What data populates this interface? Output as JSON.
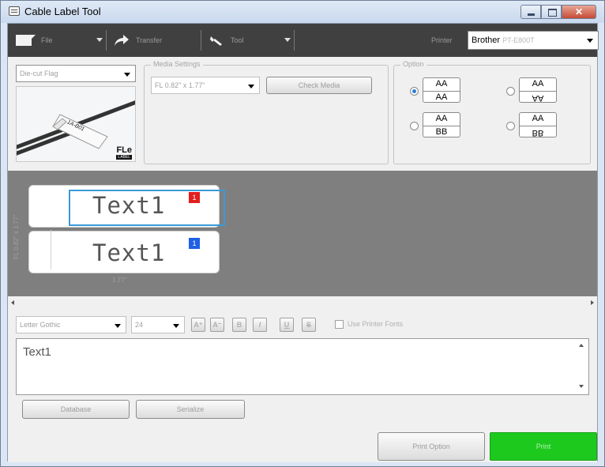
{
  "window": {
    "title": "Cable Label Tool",
    "close_glyph": "✕"
  },
  "toolbar": {
    "file_label": "File",
    "transfer_label": "Transfer",
    "tool_label": "Tool",
    "printer_label": "Printer",
    "printer_value_main": "Brother",
    "printer_value_model": "PT-E800T"
  },
  "settings": {
    "application_type": "Die-cut Flag",
    "media_group_label": "Media Settings",
    "media_size": "FL 0.82\" x 1.77\"",
    "check_media_label": "Check Media",
    "option_group_label": "Option",
    "options": [
      {
        "top": "AA",
        "bottom": "AA",
        "flipped": false,
        "selected": true
      },
      {
        "top": "AA",
        "bottom": "AA",
        "flipped": true,
        "selected": false
      },
      {
        "top": "AA",
        "bottom": "BB",
        "flipped": false,
        "selected": false
      },
      {
        "top": "AA",
        "bottom": "BB",
        "flipped": true,
        "selected": false
      }
    ],
    "flag_image": {
      "cable_text": "1A-B01",
      "logo_text": "FLe",
      "logo_sub": "LABEL"
    }
  },
  "preview": {
    "labels": [
      {
        "text": "Text1",
        "badge": "1",
        "badge_color": "#e21e1e"
      },
      {
        "text": "Text1",
        "badge": "1",
        "badge_color": "#1e60e6"
      }
    ],
    "vertical_dimension": "FL 0.82\" x 1.77\"",
    "horizontal_dimension": "1.77\""
  },
  "editor": {
    "font_family": "Letter Gothic",
    "font_size": "24",
    "use_printer_fonts_label": "Use Printer Fonts",
    "text_value": "Text1",
    "format_buttons": [
      {
        "name": "font-size-increase-button",
        "glyph": "A⁺"
      },
      {
        "name": "font-size-decrease-button",
        "glyph": "A⁻"
      },
      {
        "name": "bold-button",
        "glyph": "B"
      },
      {
        "name": "italic-button",
        "glyph": "I"
      },
      {
        "name": "underline-button",
        "glyph": "U"
      },
      {
        "name": "strikethrough-button",
        "glyph": "S"
      }
    ],
    "database_label": "Database",
    "serialize_label": "Serialize",
    "print_option_label": "Print Option",
    "print_label": "Print"
  },
  "colors": {
    "print_button": "#1ec91e",
    "toolbar_bg": "#404040",
    "preview_bg": "#7f7f7f",
    "selection_border": "#3a9ad9"
  }
}
